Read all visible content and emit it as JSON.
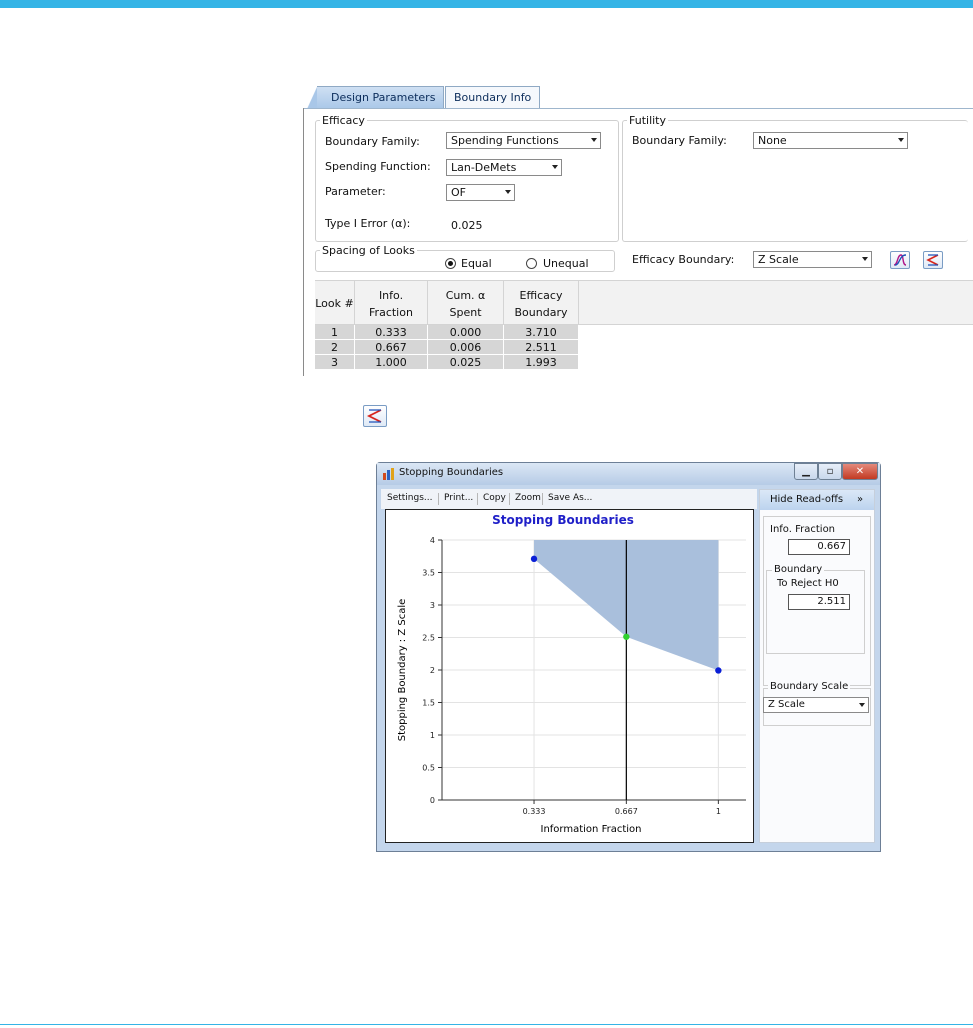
{
  "colors": {
    "accent": "#35b4e6",
    "boundary_fill": "#a9bfdc",
    "point": "#0a1fd6",
    "point_current": "#2fd12f"
  },
  "tabs": [
    {
      "label": "Design Parameters"
    },
    {
      "label": "Boundary Info"
    }
  ],
  "efficacy": {
    "legend": "Efficacy",
    "boundary_family_label": "Boundary Family:",
    "boundary_family_value": "Spending Functions",
    "spending_function_label": "Spending Function:",
    "spending_function_value": "Lan-DeMets",
    "parameter_label": "Parameter:",
    "parameter_value": "OF",
    "type1_label": "Type I Error (α):",
    "type1_value": "0.025"
  },
  "futility": {
    "legend": "Futility",
    "boundary_family_label": "Boundary Family:",
    "boundary_family_value": "None"
  },
  "spacing": {
    "legend": "Spacing of Looks",
    "equal": "Equal",
    "unequal": "Unequal",
    "selected": "Equal"
  },
  "efficacy_boundary": {
    "label": "Efficacy Boundary:",
    "value": "Z Scale"
  },
  "table": {
    "headers": [
      [
        "Look #"
      ],
      [
        "Info.",
        "Fraction"
      ],
      [
        "Cum. α",
        "Spent"
      ],
      [
        "Efficacy",
        "Boundary"
      ]
    ],
    "rows": [
      [
        "1",
        "0.333",
        "0.000",
        "3.710"
      ],
      [
        "2",
        "0.667",
        "0.006",
        "2.511"
      ],
      [
        "3",
        "1.000",
        "0.025",
        "1.993"
      ]
    ]
  },
  "window": {
    "title": "Stopping Boundaries",
    "toolbar": [
      "Settings...",
      "Print...",
      "Copy",
      "Zoom",
      "Save As..."
    ],
    "hide_readoffs": "Hide Read-offs",
    "hide_readoffs_glyph": "»",
    "info_fraction_label": "Info. Fraction",
    "info_fraction_value": "0.667",
    "boundary_legend": "Boundary",
    "to_reject_label": "To Reject H0",
    "to_reject_value": "2.511",
    "boundary_scale_legend": "Boundary Scale",
    "boundary_scale_value": "Z Scale"
  },
  "chart_data": {
    "type": "area",
    "title": "Stopping Boundaries",
    "xlabel": "Information Fraction",
    "ylabel": "Stopping Boundary : Z Scale",
    "x": [
      0.333,
      0.667,
      1
    ],
    "x_tick_labels": [
      "0.333",
      "0.667",
      "1"
    ],
    "y": [
      3.71,
      2.511,
      1.993
    ],
    "ylim": [
      0,
      4
    ],
    "y_ticks": [
      "0",
      "0.5",
      "1",
      "1.5",
      "2",
      "2.5",
      "3",
      "3.5",
      "4"
    ],
    "selected_x": 0.667,
    "grid": true
  }
}
